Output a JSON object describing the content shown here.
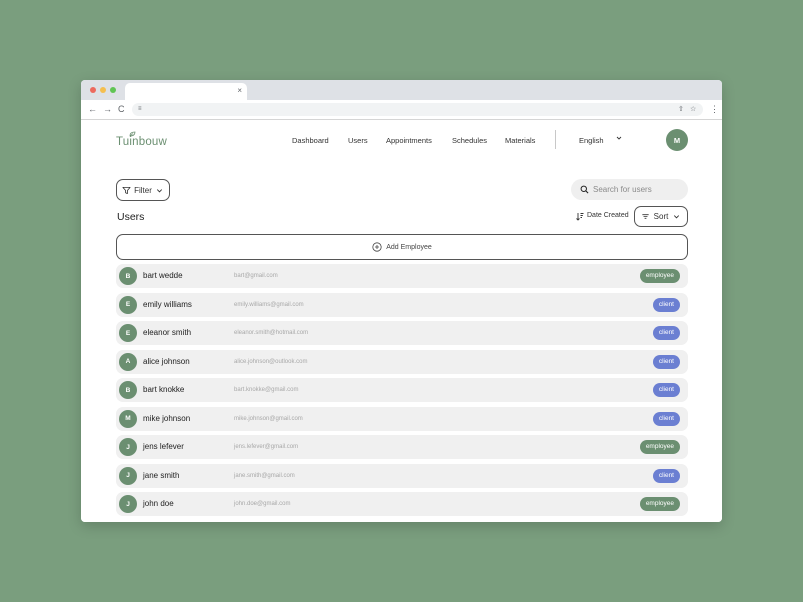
{
  "browser": {
    "tab_close": "×",
    "nav_back": "←",
    "nav_forward": "→",
    "nav_reload": "C",
    "url_icon": "≡",
    "share_icon": "⇧",
    "star_icon": "☆",
    "menu_icon": "⋮"
  },
  "header": {
    "logo": "Tuinbouw",
    "nav": [
      "Dashboard",
      "Users",
      "Appointments",
      "Schedules",
      "Materials"
    ],
    "language": "English",
    "avatar": "M"
  },
  "toolbar": {
    "filter_label": "Filter",
    "search_placeholder": "Search for users",
    "page_title": "Users",
    "date_created_label": "Date Created",
    "sort_label": "Sort",
    "add_employee_label": "Add Employee"
  },
  "users": [
    {
      "initial": "B",
      "name": "bart wedde",
      "email": "bart@gmail.com",
      "role": "employee"
    },
    {
      "initial": "E",
      "name": "emily williams",
      "email": "emily.williams@gmail.com",
      "role": "client"
    },
    {
      "initial": "E",
      "name": "eleanor smith",
      "email": "eleanor.smith@hotmail.com",
      "role": "client"
    },
    {
      "initial": "A",
      "name": "alice johnson",
      "email": "alice.johnson@outlook.com",
      "role": "client"
    },
    {
      "initial": "B",
      "name": "bart knokke",
      "email": "bart.knokke@gmail.com",
      "role": "client"
    },
    {
      "initial": "M",
      "name": "mike johnson",
      "email": "mike.johnson@gmail.com",
      "role": "client"
    },
    {
      "initial": "J",
      "name": "jens lefever",
      "email": "jens.lefever@gmail.com",
      "role": "employee"
    },
    {
      "initial": "J",
      "name": "jane smith",
      "email": "jane.smith@gmail.com",
      "role": "client"
    },
    {
      "initial": "J",
      "name": "john doe",
      "email": "john.doe@gmail.com",
      "role": "employee"
    }
  ],
  "colors": {
    "background": "#7a9e7e",
    "brand_green": "#6b8f71",
    "client_blue": "#6b7fd2",
    "row_gray": "#f0f0f0"
  }
}
